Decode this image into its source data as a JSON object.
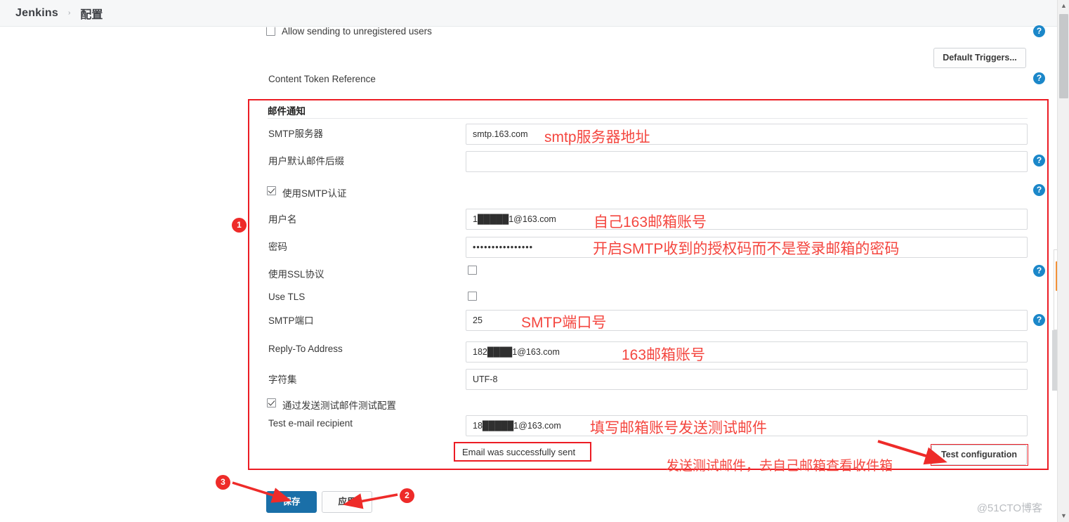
{
  "breadcrumb": {
    "home": "Jenkins",
    "separator": "›",
    "current": "配置"
  },
  "upper": {
    "allow_unregistered_label": "Allow sending to unregistered users",
    "allow_unregistered_checked": false,
    "default_triggers_button": "Default Triggers...",
    "content_token_reference_label": "Content Token Reference"
  },
  "mail_section": {
    "title": "邮件通知",
    "fields": [
      {
        "label": "SMTP服务器",
        "value": "smtp.163.com",
        "type": "text"
      },
      {
        "label": "用户默认邮件后缀",
        "value": "",
        "type": "text"
      },
      {
        "label": "使用SMTP认证",
        "value": "",
        "type": "checkbox",
        "checked": true
      },
      {
        "label": "用户名",
        "value": "1█████1@163.com",
        "type": "text"
      },
      {
        "label": "密码",
        "value": "••••••••••••••••",
        "type": "password"
      },
      {
        "label": "使用SSL协议",
        "value": "",
        "type": "checkbox",
        "checked": false
      },
      {
        "label": "Use TLS",
        "value": "",
        "type": "checkbox",
        "checked": false
      },
      {
        "label": "SMTP端口",
        "value": "25",
        "type": "text"
      },
      {
        "label": "Reply-To Address",
        "value": "182████1@163.com",
        "type": "text"
      },
      {
        "label": "字符集",
        "value": "UTF-8",
        "type": "text"
      },
      {
        "label": "通过发送测试邮件测试配置",
        "value": "",
        "type": "checkbox",
        "checked": true
      },
      {
        "label": "Test e-mail recipient",
        "value": "18█████1@163.com",
        "type": "text"
      }
    ],
    "status_message": "Email was successfully sent",
    "test_configuration_button": "Test configuration"
  },
  "annotations": [
    {
      "id": "a1",
      "text": "smtp服务器地址"
    },
    {
      "id": "a2",
      "text": "自己163邮箱账号"
    },
    {
      "id": "a3",
      "text": "开启SMTP收到的授权码而不是登录邮箱的密码"
    },
    {
      "id": "a4",
      "text": "SMTP端口号"
    },
    {
      "id": "a5",
      "text": "163邮箱账号"
    },
    {
      "id": "a6",
      "text": "填写邮箱账号发送测试邮件"
    },
    {
      "id": "a7",
      "text": "发送测试邮件，去自己邮箱查看收件箱"
    }
  ],
  "badges": [
    {
      "id": "b1",
      "number": "1"
    },
    {
      "id": "b2",
      "number": "2"
    },
    {
      "id": "b3",
      "number": "3"
    }
  ],
  "footer": {
    "save_button": "保存",
    "apply_button": "应用"
  },
  "help_icon_glyph": "?",
  "watermark": "@51CTO博客",
  "colors": {
    "accent_blue": "#1a6fa8",
    "help_blue": "#1b87c9",
    "annotation_red": "#f4463f",
    "box_red": "#ec1c24",
    "badge_red": "#ee2b29"
  }
}
